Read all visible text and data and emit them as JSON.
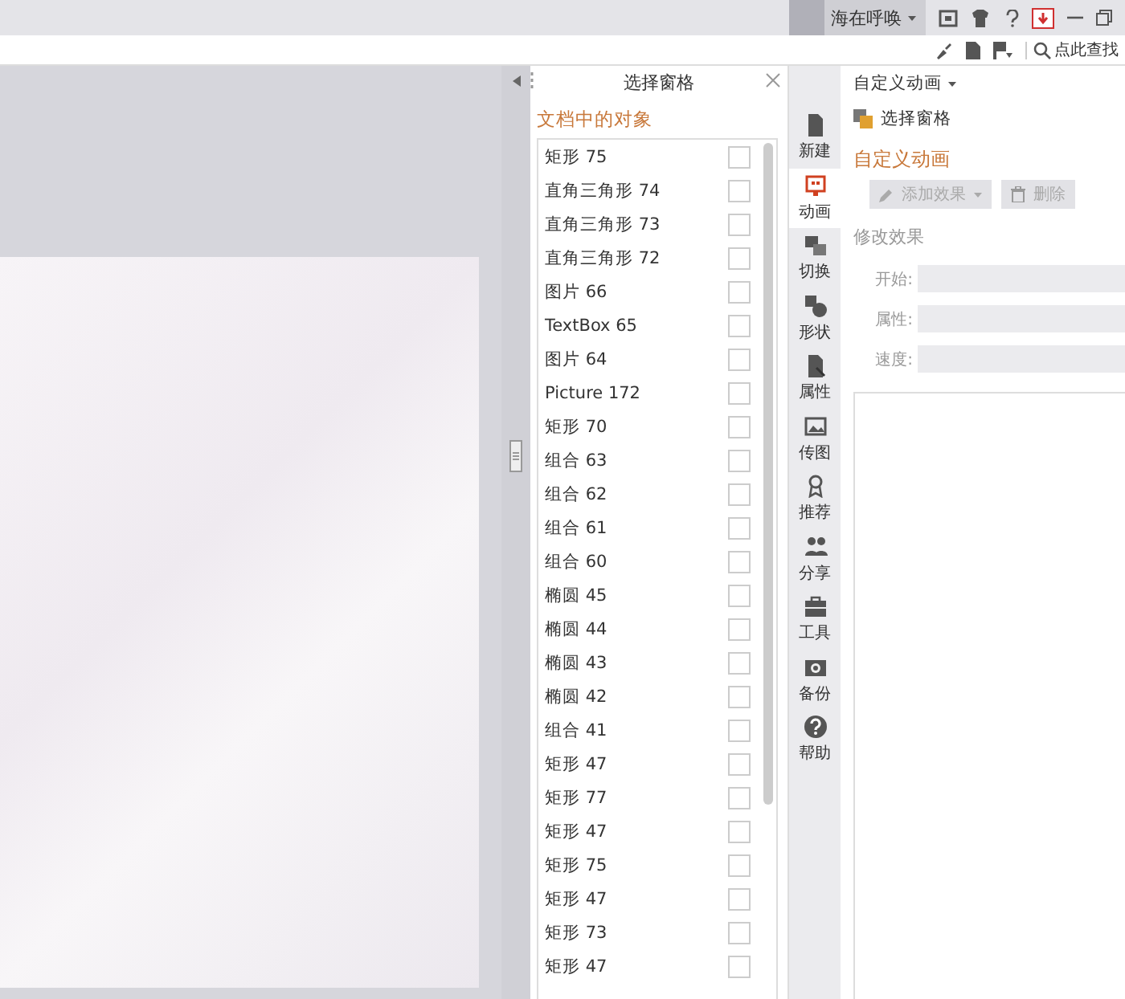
{
  "title_bar": {
    "user_name": "海在呼唤"
  },
  "toolbar": {
    "search": {
      "placeholder": "点此查找"
    }
  },
  "selection_pane": {
    "title": "选择窗格",
    "section_title": "文档中的对象",
    "objects": [
      {
        "label": "矩形 75",
        "checked": false
      },
      {
        "label": "直角三角形 74",
        "checked": false
      },
      {
        "label": "直角三角形 73",
        "checked": false
      },
      {
        "label": "直角三角形 72",
        "checked": false
      },
      {
        "label": "图片 66",
        "checked": false
      },
      {
        "label": "TextBox 65",
        "checked": false
      },
      {
        "label": "图片 64",
        "checked": false
      },
      {
        "label": "Picture 172",
        "checked": false
      },
      {
        "label": "矩形 70",
        "checked": false
      },
      {
        "label": "组合 63",
        "checked": false
      },
      {
        "label": "组合 62",
        "checked": false
      },
      {
        "label": "组合 61",
        "checked": false
      },
      {
        "label": "组合 60",
        "checked": false
      },
      {
        "label": "椭圆 45",
        "checked": false
      },
      {
        "label": "椭圆 44",
        "checked": false
      },
      {
        "label": "椭圆 43",
        "checked": false
      },
      {
        "label": "椭圆 42",
        "checked": false
      },
      {
        "label": "组合 41",
        "checked": false
      },
      {
        "label": "矩形 47",
        "checked": false
      },
      {
        "label": "矩形 77",
        "checked": false
      },
      {
        "label": "矩形 47",
        "checked": false
      },
      {
        "label": "矩形 75",
        "checked": false
      },
      {
        "label": "矩形 47",
        "checked": false
      },
      {
        "label": "矩形 73",
        "checked": false
      },
      {
        "label": "矩形 47",
        "checked": false
      }
    ]
  },
  "side_tabs": [
    {
      "label": "新建",
      "kind": "file",
      "selected": false
    },
    {
      "label": "动画",
      "kind": "animation",
      "selected": true
    },
    {
      "label": "切换",
      "kind": "switch",
      "selected": false
    },
    {
      "label": "形状",
      "kind": "shape",
      "selected": false
    },
    {
      "label": "属性",
      "kind": "property",
      "selected": false
    },
    {
      "label": "传图",
      "kind": "image",
      "selected": false
    },
    {
      "label": "推荐",
      "kind": "award",
      "selected": false
    },
    {
      "label": "分享",
      "kind": "people",
      "selected": false
    },
    {
      "label": "工具",
      "kind": "toolbox",
      "selected": false
    },
    {
      "label": "备份",
      "kind": "camera",
      "selected": false
    },
    {
      "label": "帮助",
      "kind": "help",
      "selected": false
    }
  ],
  "task_pane": {
    "title": "自定义动画",
    "link": "选择窗格",
    "heading": "自定义动画",
    "buttons": [
      {
        "label": "添加效果",
        "kind": "add",
        "disabled": true
      },
      {
        "label": "删除",
        "kind": "delete",
        "disabled": true
      }
    ],
    "modify_title": "修改效果",
    "fields": [
      {
        "label": "开始:"
      },
      {
        "label": "属性:"
      },
      {
        "label": "速度:"
      }
    ]
  }
}
